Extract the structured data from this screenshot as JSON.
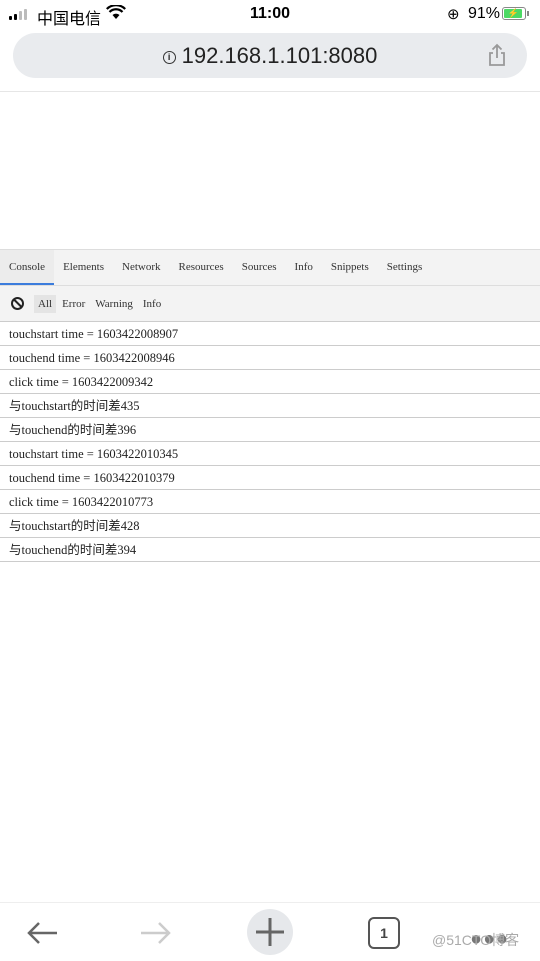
{
  "status_bar": {
    "carrier": "中国电信",
    "time": "11:00",
    "battery": "91%",
    "battery_level": 0.91,
    "signal_bars": 2
  },
  "browser": {
    "url": "192.168.1.101:8080"
  },
  "devtools": {
    "tabs": [
      "Console",
      "Elements",
      "Network",
      "Resources",
      "Sources",
      "Info",
      "Snippets",
      "Settings"
    ],
    "active_tab": "Console",
    "filters": [
      "All",
      "Error",
      "Warning",
      "Info"
    ],
    "active_filter": "All",
    "logs": [
      "touchstart time = 1603422008907",
      "touchend time = 1603422008946",
      "click time = 1603422009342",
      "与touchstart的时间差435",
      "与touchend的时间差396",
      "touchstart time = 1603422010345",
      "touchend time = 1603422010379",
      "click time = 1603422010773",
      "与touchstart的时间差428",
      "与touchend的时间差394"
    ]
  },
  "toolbar": {
    "tab_count": "1"
  },
  "watermark": "@51CTO博客",
  "colors": {
    "accent": "#3b7cdc",
    "battery": "#4cd964"
  }
}
